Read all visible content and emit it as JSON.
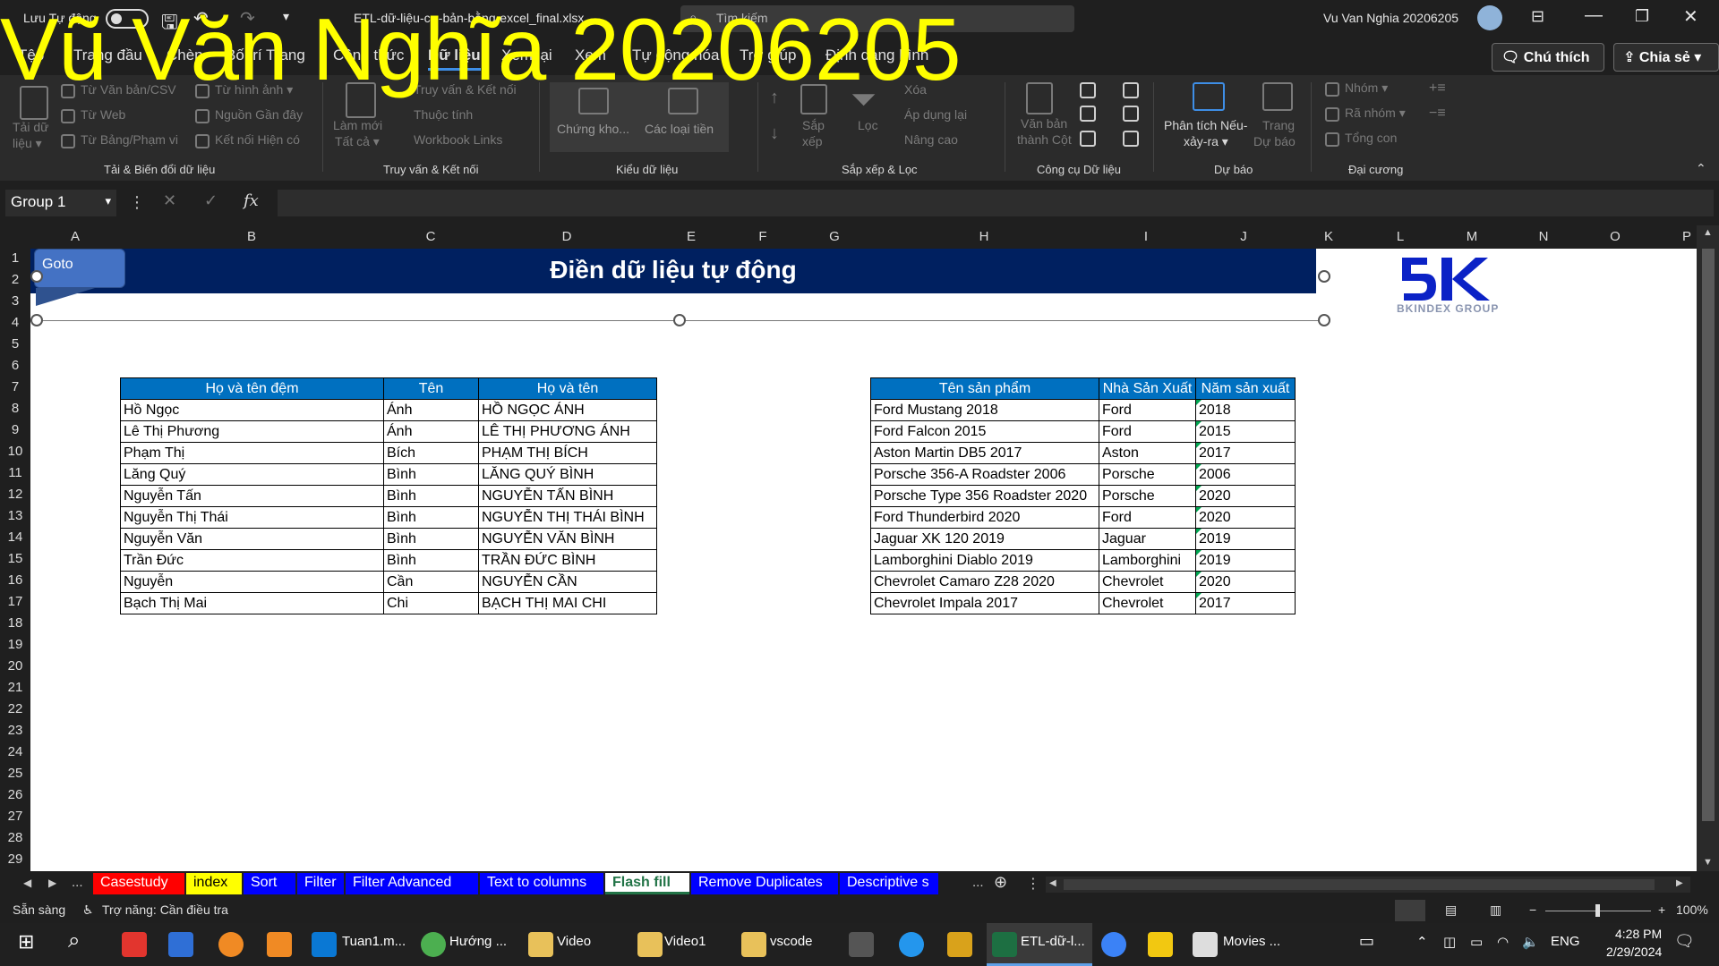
{
  "watermark": "Vũ Văn Nghĩa 20206205",
  "titlebar": {
    "autosave_label": "Lưu Tự động",
    "file_name": "ETL-dữ-liệu-cơ-bản-bằng-excel_final.xlsx",
    "search_placeholder": "Tìm kiếm",
    "user_name": "Vu Van Nghia 20206205"
  },
  "ribbon_tabs": [
    "Tệp",
    "Trang đầu",
    "Chèn",
    "Bố trí Trang",
    "Công thức",
    "Dữ liệu",
    "Xem lại",
    "Xem",
    "Tự động hóa",
    "Trợ giúp",
    "Định dạng hình"
  ],
  "top_buttons": {
    "comment": "Chú thích",
    "share": "Chia sẻ"
  },
  "ribbon": {
    "get_data": {
      "label": "Tải dữ liệu",
      "line1": "Tải dữ",
      "line2": "liệu ▾"
    },
    "from_text": "Từ Văn bản/CSV",
    "from_web": "Từ Web",
    "from_table": "Từ Bảng/Phạm vi",
    "from_picture": "Từ hình ảnh ▾",
    "recent_sources": "Nguồn Gần đây",
    "existing_connections": "Kết nối Hiện có",
    "group_get": "Tải & Biến đổi dữ liệu",
    "refresh_line1": "Làm mới",
    "refresh_line2": "Tất cả ▾",
    "queries": "Truy vấn & Kết nối",
    "properties": "Thuộc tính",
    "workbook_links": "Workbook Links",
    "group_queries": "Truy vấn & Kết nối",
    "stocks": "Chứng kho...",
    "types": "Các loại tiền",
    "group_types": "Kiểu dữ liệu",
    "sort_line1": "Sắp",
    "sort_line2": "xếp",
    "filter": "Lọc",
    "clear": "Xóa",
    "reapply": "Áp dụng lại",
    "advanced": "Nâng cao",
    "group_sort": "Sắp xếp & Lọc",
    "text_to_cols_line1": "Văn bản",
    "text_to_cols_line2": "thành Cột",
    "group_tools": "Công cụ Dữ liệu",
    "whatif_line1": "Phân tích Nếu-",
    "whatif_line2": "xảy-ra ▾",
    "forecast_line1": "Trang",
    "forecast_line2": "Dự báo",
    "group_forecast": "Dự báo",
    "group_ol": "Nhóm ▾",
    "ungroup": "Rã nhóm ▾",
    "subtotal": "Tổng con",
    "group_outline": "Đại cương"
  },
  "formula_bar": {
    "name_box": "Group 1",
    "fx": "fx",
    "content": ""
  },
  "columns": [
    "A",
    "B",
    "C",
    "D",
    "E",
    "F",
    "G",
    "H",
    "I",
    "J",
    "K",
    "L",
    "M",
    "N",
    "O",
    "P"
  ],
  "rows": [
    "1",
    "2",
    "3",
    "4",
    "5",
    "6",
    "7",
    "8",
    "9",
    "10",
    "11",
    "12",
    "13",
    "14",
    "15",
    "16",
    "17",
    "18",
    "19",
    "20",
    "21",
    "22",
    "23",
    "24",
    "25",
    "26",
    "27",
    "28",
    "29"
  ],
  "sheet": {
    "banner_title": "Điền dữ liệu tự động",
    "goto_button": "Goto",
    "logo_text": "BKINDEX GROUP",
    "names_table": {
      "headers": [
        "Họ và tên đệm",
        "Tên",
        "Họ và tên"
      ],
      "rows": [
        [
          "Hồ Ngọc",
          "Ánh",
          "HỒ NGỌC ÁNH"
        ],
        [
          "Lê Thị Phương",
          "Ánh",
          "LÊ THỊ PHƯƠNG ÁNH"
        ],
        [
          "Phạm Thị",
          "Bích",
          "PHẠM THỊ BÍCH"
        ],
        [
          "Lăng Quý",
          "Bình",
          "LĂNG QUÝ BÌNH"
        ],
        [
          "Nguyễn Tấn",
          "Bình",
          "NGUYỄN TẤN BÌNH"
        ],
        [
          "Nguyễn Thị Thái",
          "Bình",
          "NGUYỄN THỊ THÁI BÌNH"
        ],
        [
          "Nguyễn Văn",
          "Bình",
          "NGUYỄN VĂN BÌNH"
        ],
        [
          "Trần Đức",
          "Bình",
          "TRẦN ĐỨC BÌNH"
        ],
        [
          "Nguyễn",
          "Cần",
          "NGUYỄN CẦN"
        ],
        [
          "Bạch Thị Mai",
          "Chi",
          "BẠCH THỊ MAI CHI"
        ]
      ]
    },
    "products_table": {
      "headers": [
        "Tên sản phẩm",
        "Nhà Sản Xuất",
        "Năm sản xuất"
      ],
      "rows": [
        [
          "Ford Mustang 2018",
          "Ford",
          "2018"
        ],
        [
          "Ford Falcon 2015",
          "Ford",
          "2015"
        ],
        [
          "Aston Martin DB5 2017",
          "Aston",
          "2017"
        ],
        [
          "Porsche 356-A Roadster 2006",
          "Porsche",
          "2006"
        ],
        [
          "Porsche Type 356 Roadster 2020",
          "Porsche",
          "2020"
        ],
        [
          "Ford Thunderbird 2020",
          "Ford",
          "2020"
        ],
        [
          "Jaguar XK 120 2019",
          "Jaguar",
          "2019"
        ],
        [
          "Lamborghini Diablo 2019",
          "Lamborghini",
          "2019"
        ],
        [
          "Chevrolet Camaro Z28 2020",
          "Chevrolet",
          "2020"
        ],
        [
          "Chevrolet Impala 2017",
          "Chevrolet",
          "2017"
        ]
      ]
    }
  },
  "sheet_tabs": [
    {
      "label": "Casestudy",
      "bg": "#ff0000"
    },
    {
      "label": "index",
      "bg": "#ffff00",
      "fg": "#000000"
    },
    {
      "label": "Sort",
      "bg": "#0000ff"
    },
    {
      "label": "Filter",
      "bg": "#0000ff"
    },
    {
      "label": "Filter Advanced",
      "bg": "#0000ff"
    },
    {
      "label": "Text to columns",
      "bg": "#0000ff"
    },
    {
      "label": "Flash fill",
      "active": true
    },
    {
      "label": "Remove Duplicates",
      "bg": "#0000ff"
    },
    {
      "label": "Descriptive s",
      "bg": "#0000ff"
    }
  ],
  "sheet_nav": {
    "more": "...",
    "ellipsis": "..."
  },
  "status": {
    "ready": "Sẵn sàng",
    "accessibility": "Trợ năng: Cần điều tra",
    "zoom": "100%"
  },
  "taskbar": {
    "items": [
      "Tuan1.m...",
      "Hướng ...",
      "Video",
      "Video1",
      "vscode",
      "ETL-dữ-l...",
      "Movies ..."
    ],
    "lang": "ENG",
    "time": "4:28 PM",
    "date": "2/29/2024"
  }
}
